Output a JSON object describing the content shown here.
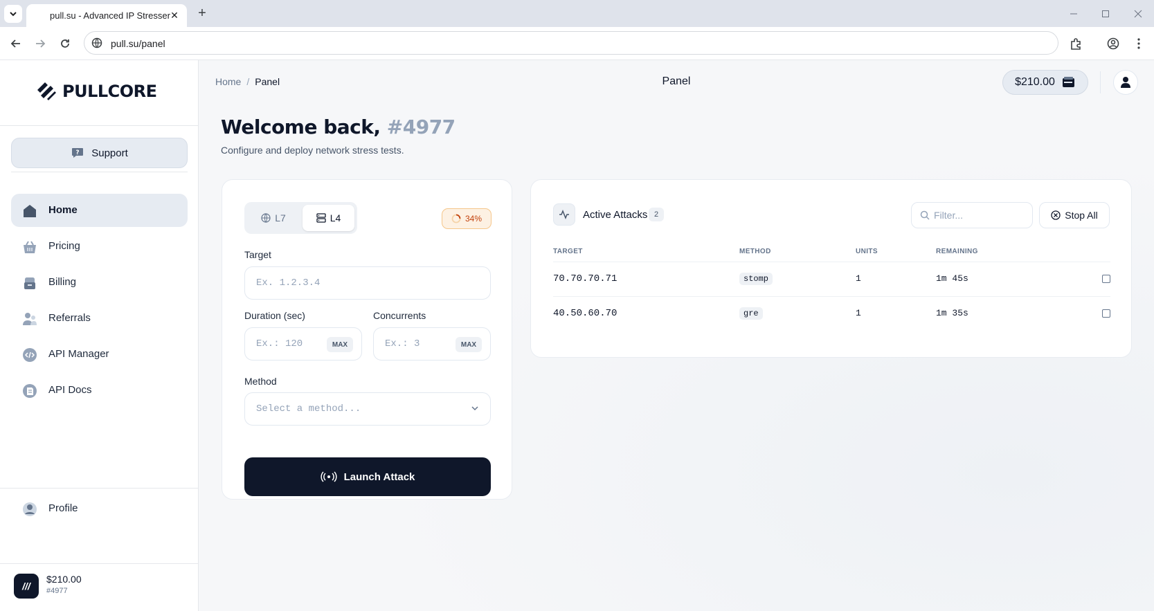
{
  "browser": {
    "tab_title": "pull.su - Advanced IP Stresser",
    "url": "pull.su/panel"
  },
  "sidebar": {
    "brand": "PULLCORE",
    "support_label": "Support",
    "items": [
      {
        "label": "Home",
        "icon": "home-icon",
        "active": true
      },
      {
        "label": "Pricing",
        "icon": "basket-icon"
      },
      {
        "label": "Billing",
        "icon": "wallet-icon"
      },
      {
        "label": "Referrals",
        "icon": "users-icon"
      },
      {
        "label": "API Manager",
        "icon": "code-icon"
      },
      {
        "label": "API Docs",
        "icon": "docs-icon"
      }
    ],
    "profile_label": "Profile",
    "user": {
      "badge": "///",
      "balance": "$210.00",
      "id": "#4977"
    }
  },
  "header": {
    "breadcrumb": {
      "home": "Home",
      "sep": "/",
      "current": "Panel"
    },
    "title": "Panel",
    "balance": "$210.00"
  },
  "welcome": {
    "greeting": "Welcome back,",
    "user_id": "#4977",
    "subtitle": "Configure and deploy network stress tests."
  },
  "form": {
    "layer_tabs": [
      {
        "label": "L7"
      },
      {
        "label": "L4",
        "selected": true
      }
    ],
    "usage_badge": "34%",
    "usage_fraction": 0.34,
    "target_label": "Target",
    "target_placeholder": "Ex. 1.2.3.4",
    "duration_label": "Duration (sec)",
    "duration_placeholder": "Ex.: 120",
    "concurrents_label": "Concurrents",
    "concurrents_placeholder": "Ex.: 3",
    "max_label": "MAX",
    "method_label": "Method",
    "method_placeholder": "Select a method...",
    "launch_label": "Launch Attack"
  },
  "attacks": {
    "title": "Active Attacks",
    "count": "2",
    "filter_placeholder": "Filter...",
    "stop_all_label": "Stop All",
    "columns": [
      "TARGET",
      "METHOD",
      "UNITS",
      "REMAINING"
    ],
    "rows": [
      {
        "target": "70.70.70.71",
        "method": "stomp",
        "units": "1",
        "remaining": "1m 45s"
      },
      {
        "target": "40.50.60.70",
        "method": "gre",
        "units": "1",
        "remaining": "1m 35s"
      }
    ]
  },
  "colors": {
    "primary_dark": "#0f172a",
    "accent_soft": "#e6ebf2",
    "muted": "#94a3b8",
    "warning": "#c2410c"
  }
}
